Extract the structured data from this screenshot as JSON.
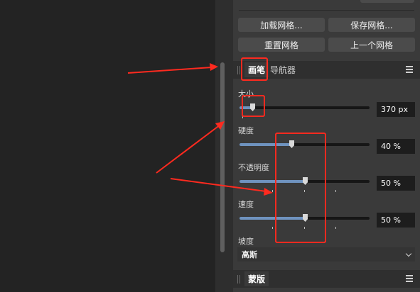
{
  "colors": {
    "accent": "#6f93bf",
    "annotation": "#ff2a1f"
  },
  "grid_buttons": {
    "load": "加载网格...",
    "save": "保存网格...",
    "reset": "重置网格",
    "previous": "上一个网格"
  },
  "brush_panel": {
    "tab_active": "画笔",
    "tab_navigator": "导航器",
    "size": {
      "label": "大小",
      "value": "370 px",
      "level": 0.1
    },
    "hardness": {
      "label": "硬度",
      "value": "40 %",
      "level": 0.4
    },
    "opacity": {
      "label": "不透明度",
      "value": "50 %",
      "level": 0.5
    },
    "speed": {
      "label": "速度",
      "value": "50 %",
      "level": 0.5
    },
    "falloff": {
      "label": "坡度",
      "selected": "高斯"
    }
  },
  "mask_panel": {
    "tab_active": "蒙版"
  },
  "icons": [
    "grip-icon",
    "menu-icon",
    "chevron-down-icon",
    "slider-handle-icon"
  ]
}
